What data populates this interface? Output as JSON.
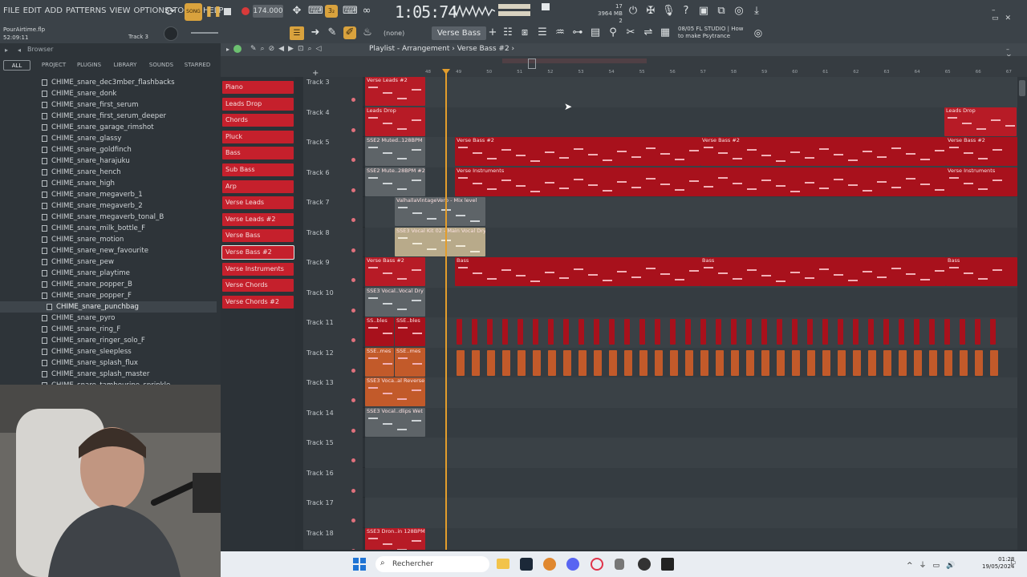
{
  "menu": [
    "FILE",
    "EDIT",
    "ADD",
    "PATTERNS",
    "VIEW",
    "OPTIONS",
    "TOOLS",
    "HELP"
  ],
  "transport": {
    "mode": "SONG",
    "bpm": "174.000",
    "time": "1:05:74"
  },
  "system_stats": {
    "cpu": "17",
    "ram": "3964 MB",
    "voices": "2"
  },
  "project": {
    "file": "PourAirtime.flp",
    "length": "52:09:11",
    "track": "Track 3"
  },
  "pattern_selector": "Verse Bass #2",
  "none_label": "(none)",
  "hint": {
    "date": "08/05",
    "line1": "FL STUDIO | How",
    "line2": "to make Psytrance"
  },
  "browser": {
    "title": "Browser",
    "tabs": [
      "ALL",
      "PROJECT",
      "PLUGINS",
      "LIBRARY",
      "SOUNDS",
      "STARRED"
    ],
    "items": [
      "CHIME_snare_dec3mber_flashbacks",
      "CHIME_snare_donk",
      "CHIME_snare_first_serum",
      "CHIME_snare_first_serum_deeper",
      "CHIME_snare_garage_rimshot",
      "CHIME_snare_glassy",
      "CHIME_snare_goldfinch",
      "CHIME_snare_harajuku",
      "CHIME_snare_hench",
      "CHIME_snare_high",
      "CHIME_snare_megaverb_1",
      "CHIME_snare_megaverb_2",
      "CHIME_snare_megaverb_tonal_B",
      "CHIME_snare_milk_bottle_F",
      "CHIME_snare_motion",
      "CHIME_snare_new_favourite",
      "CHIME_snare_pew",
      "CHIME_snare_playtime",
      "CHIME_snare_popper_B",
      "CHIME_snare_popper_F",
      "CHIME_snare_punchbag",
      "CHIME_snare_pyro",
      "CHIME_snare_ring_F",
      "CHIME_snare_ringer_solo_F",
      "CHIME_snare_sleepless",
      "CHIME_snare_splash_flux",
      "CHIME_snare_splash_master",
      "CHIME_snare_tambourine_sprinkle"
    ],
    "selected_index": 20
  },
  "playlist": {
    "title": "Playlist - Arrangement",
    "pattern": "Verse Bass #2",
    "ruler": [
      "48",
      "49",
      "50",
      "51",
      "52",
      "53",
      "54",
      "55",
      "56",
      "57",
      "58",
      "59",
      "60",
      "61",
      "62",
      "63",
      "64",
      "65",
      "66",
      "67"
    ],
    "patterns": [
      "Piano",
      "Leads Drop",
      "Chords",
      "Pluck",
      "Bass",
      "Sub Bass",
      "Arp",
      "Verse Leads",
      "Verse Leads #2",
      "Verse Bass",
      "Verse Bass #2",
      "Verse Instruments",
      "Verse Chords",
      "Verse Chords #2"
    ],
    "selected_pattern": 10,
    "tracks": [
      "Track 3",
      "Track 4",
      "Track 5",
      "Track 6",
      "Track 7",
      "Track 8",
      "Track 9",
      "Track 10",
      "Track 11",
      "Track 12",
      "Track 13",
      "Track 14",
      "Track 15",
      "Track 16",
      "Track 17",
      "Track 18"
    ],
    "clips": {
      "t3": "Verse Leads #2",
      "t4a": "Leads Drop",
      "t4b": "Leads Drop",
      "t5a": "SSE2 Muted..128BPM",
      "t5b": "Verse Bass #2",
      "t5c": "Verse Bass #2",
      "t5d": "Verse Bass #2",
      "t6a": "SSE2 Mute..28BPM #2",
      "t6b": "Verse Instruments",
      "t6c": "Verse Instruments",
      "t7": "ValhallaVintageVerb - Mix level",
      "t8": "SSE3 Vocal Kit 02 - Main Vocal Dry",
      "t9a": "Verse Bass #2",
      "t9b": "Bass",
      "t9c": "Bass",
      "t9d": "Bass",
      "t10": "SSE3 Vocal..Vocal Dry",
      "t11": "SS..bles",
      "t11b": "SSE..bles",
      "t12": "SSE..mes",
      "t12b": "SSE..mes",
      "t13": "SSE3 Voca..al Reverse",
      "t14": "SSE3 Vocal..dlips Wet",
      "t18": "SSE3 Dron..in 128BPM"
    }
  },
  "taskbar": {
    "search_placeholder": "Rechercher",
    "time": "01:28",
    "date": "19/05/2024"
  },
  "colors": {
    "pattern_red": "#c5202c",
    "playhead": "#e39d2c",
    "song_mode": "#d9a23d"
  }
}
